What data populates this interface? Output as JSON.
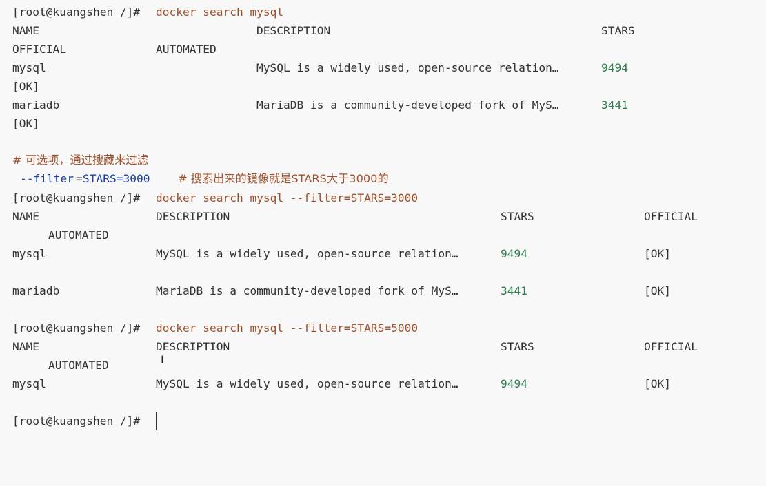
{
  "prompt": "[root@kuangshen /]#",
  "block1": {
    "command": "docker search mysql",
    "headers": {
      "name": "NAME",
      "description": "DESCRIPTION",
      "stars": "STARS",
      "official": "OFFICIAL",
      "automated": "AUTOMATED"
    },
    "rows": [
      {
        "name": "mysql",
        "description": "MySQL is a widely used, open-source relation…",
        "stars": "9494",
        "official": "[OK]"
      },
      {
        "name": "mariadb",
        "description": "MariaDB is a community-developed fork of MyS…",
        "stars": "3441",
        "official": "[OK]"
      }
    ]
  },
  "comments": {
    "line1": "# 可选项，通过搜藏来过滤",
    "line2_flag": "--filter",
    "line2_op": "=",
    "line2_value": "STARS=3000",
    "line2_comment": "# 搜索出来的镜像就是STARS大于3000的"
  },
  "block2": {
    "command": "docker search mysql --filter=STARS=3000",
    "headers": {
      "name": "NAME",
      "description": "DESCRIPTION",
      "stars": "STARS",
      "official": "OFFICIAL",
      "automated": "AUTOMATED"
    },
    "rows": [
      {
        "name": "mysql",
        "description": "MySQL is a widely used, open-source relation…",
        "stars": "9494",
        "official": "[OK]"
      },
      {
        "name": "mariadb",
        "description": "MariaDB is a community-developed fork of MyS…",
        "stars": "3441",
        "official": "[OK]"
      }
    ]
  },
  "block3": {
    "command": "docker search mysql --filter=STARS=5000",
    "headers": {
      "name": "NAME",
      "description": "DESCRIPTION",
      "stars": "STARS",
      "official": "OFFICIAL",
      "automated": "AUTOMATED"
    },
    "rows": [
      {
        "name": "mysql",
        "description": "MySQL is a widely used, open-source relation…",
        "stars": "9494",
        "official": "[OK]"
      }
    ]
  },
  "final_prompt": "[root@kuangshen /]#",
  "colors": {
    "background": "#f8f8f8",
    "text": "#333333",
    "command": "#a0522d",
    "number": "#2e7d4f",
    "flag": "#1a3fa8"
  },
  "icons": {
    "text_cursor": "i-beam-cursor-icon"
  }
}
